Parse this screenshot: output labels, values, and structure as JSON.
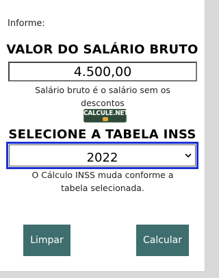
{
  "form": {
    "prompt": "Informe:",
    "salary_title": "VALOR DO SALÁRIO BRUTO",
    "salary_value": "4.500,00",
    "salary_hint": "Salário bruto é o salário sem os descontos",
    "logo_text": "CALCULE.NET",
    "table_title": "SELECIONE A TABELA INSS",
    "table_selected": "2022",
    "table_hint": "O Cálculo INSS muda conforme a tabela selecionada."
  },
  "buttons": {
    "clear_label": "Limpar",
    "calculate_label": "Calcular"
  },
  "icons": {
    "select_arrow": "chevron-down-icon"
  },
  "colors": {
    "button_bg": "#3f6e6e",
    "select_focus_border": "#1b2fd4",
    "logo_bg": "#2f4a38"
  }
}
